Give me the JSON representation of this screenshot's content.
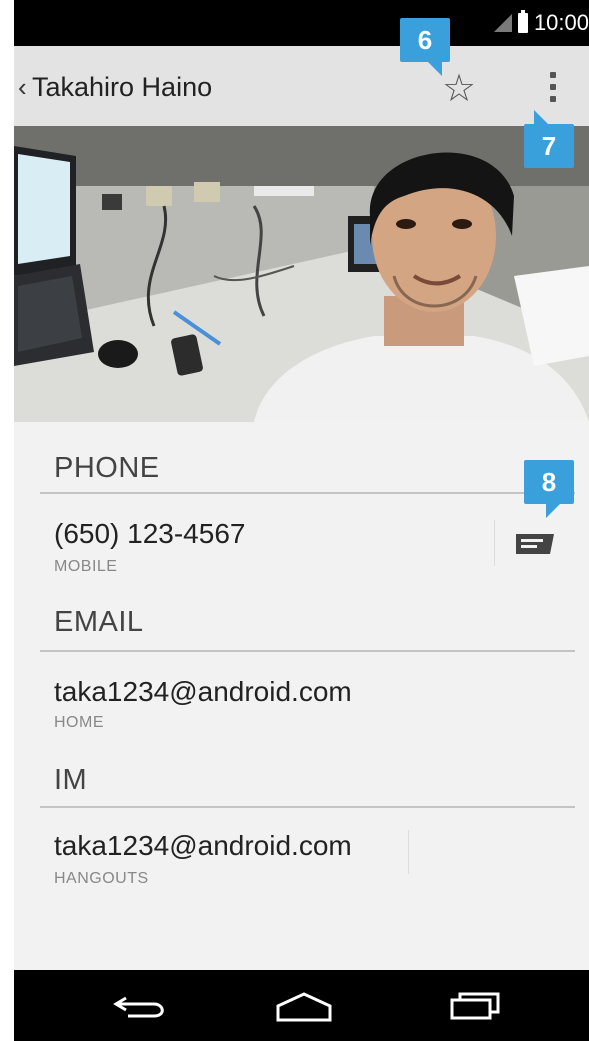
{
  "status_bar": {
    "time": "10:00",
    "icons": [
      "signal-icon",
      "battery-icon"
    ]
  },
  "action_bar": {
    "back_icon": "‹",
    "contact_name": "Takahiro Haino",
    "star_icon": "☆",
    "overflow_icon": "overflow-menu-icon"
  },
  "photo": {
    "description_icon": "contact-photo"
  },
  "callouts": [
    "6",
    "7",
    "8"
  ],
  "sections": [
    {
      "header": "PHONE",
      "value": "(650) 123-4567",
      "type": "MOBILE",
      "action_icon": "message-icon"
    },
    {
      "header": "EMAIL",
      "value": "taka1234@android.com",
      "type": "HOME"
    },
    {
      "header": "IM",
      "value": "taka1234@android.com",
      "type": "HANGOUTS"
    }
  ],
  "nav_bar": {
    "icons": [
      "back-nav-icon",
      "home-nav-icon",
      "recents-nav-icon"
    ]
  },
  "colors": {
    "callout": "#3aa0dc",
    "action_bar": "#e3e3e3",
    "background": "#f2f2f2"
  }
}
